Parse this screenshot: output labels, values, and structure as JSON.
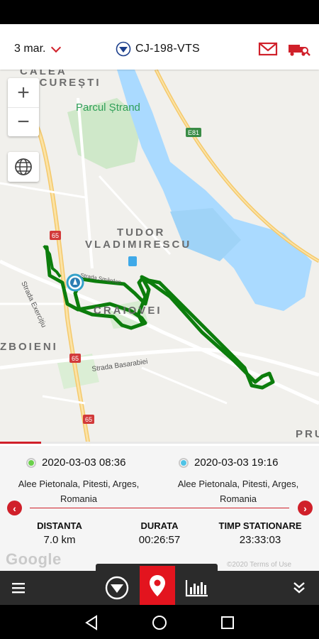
{
  "header": {
    "date": "3 mar.",
    "vehicle_id": "CJ-198-VTS"
  },
  "map": {
    "labels": {
      "calea": "CALEA",
      "bucuresti": "BUCUREȘTI",
      "park": "Parcul Ștrand",
      "tudor": "TUDOR",
      "vladimirescu": "VLADIMIRESCU",
      "craiovei": "CRAIOVEI",
      "razboieni": "ZBOIENI",
      "pru": "PRU",
      "strada_exercitiu": "Strada Exercițiu",
      "strada_basarabiei": "Strada Basarabiei",
      "strada_smardan": "Strada Smârdan",
      "e81": "E81",
      "road65": "65"
    },
    "route_color": "#0c7d0c"
  },
  "trip": {
    "start": {
      "datetime": "2020-03-03 08:36",
      "address": "Alee Pietonala, Pitesti, Arges, Romania",
      "dot_color": "#6ad04a"
    },
    "end": {
      "datetime": "2020-03-03 19:16",
      "address": "Alee Pietonala, Pitesti, Arges, Romania",
      "dot_color": "#4fc3e6"
    },
    "stats": [
      {
        "label": "DISTANTA",
        "value": "7.0 km"
      },
      {
        "label": "DURATA",
        "value": "00:26:57"
      },
      {
        "label": "TIMP STATIONARE",
        "value": "23:33:03"
      }
    ],
    "google_watermark": "Google",
    "attribution": "©2020   Terms of Use"
  },
  "colors": {
    "accent": "#d0202a",
    "active_tab": "#e3141e",
    "bottom_bar": "#2b2b2b"
  }
}
